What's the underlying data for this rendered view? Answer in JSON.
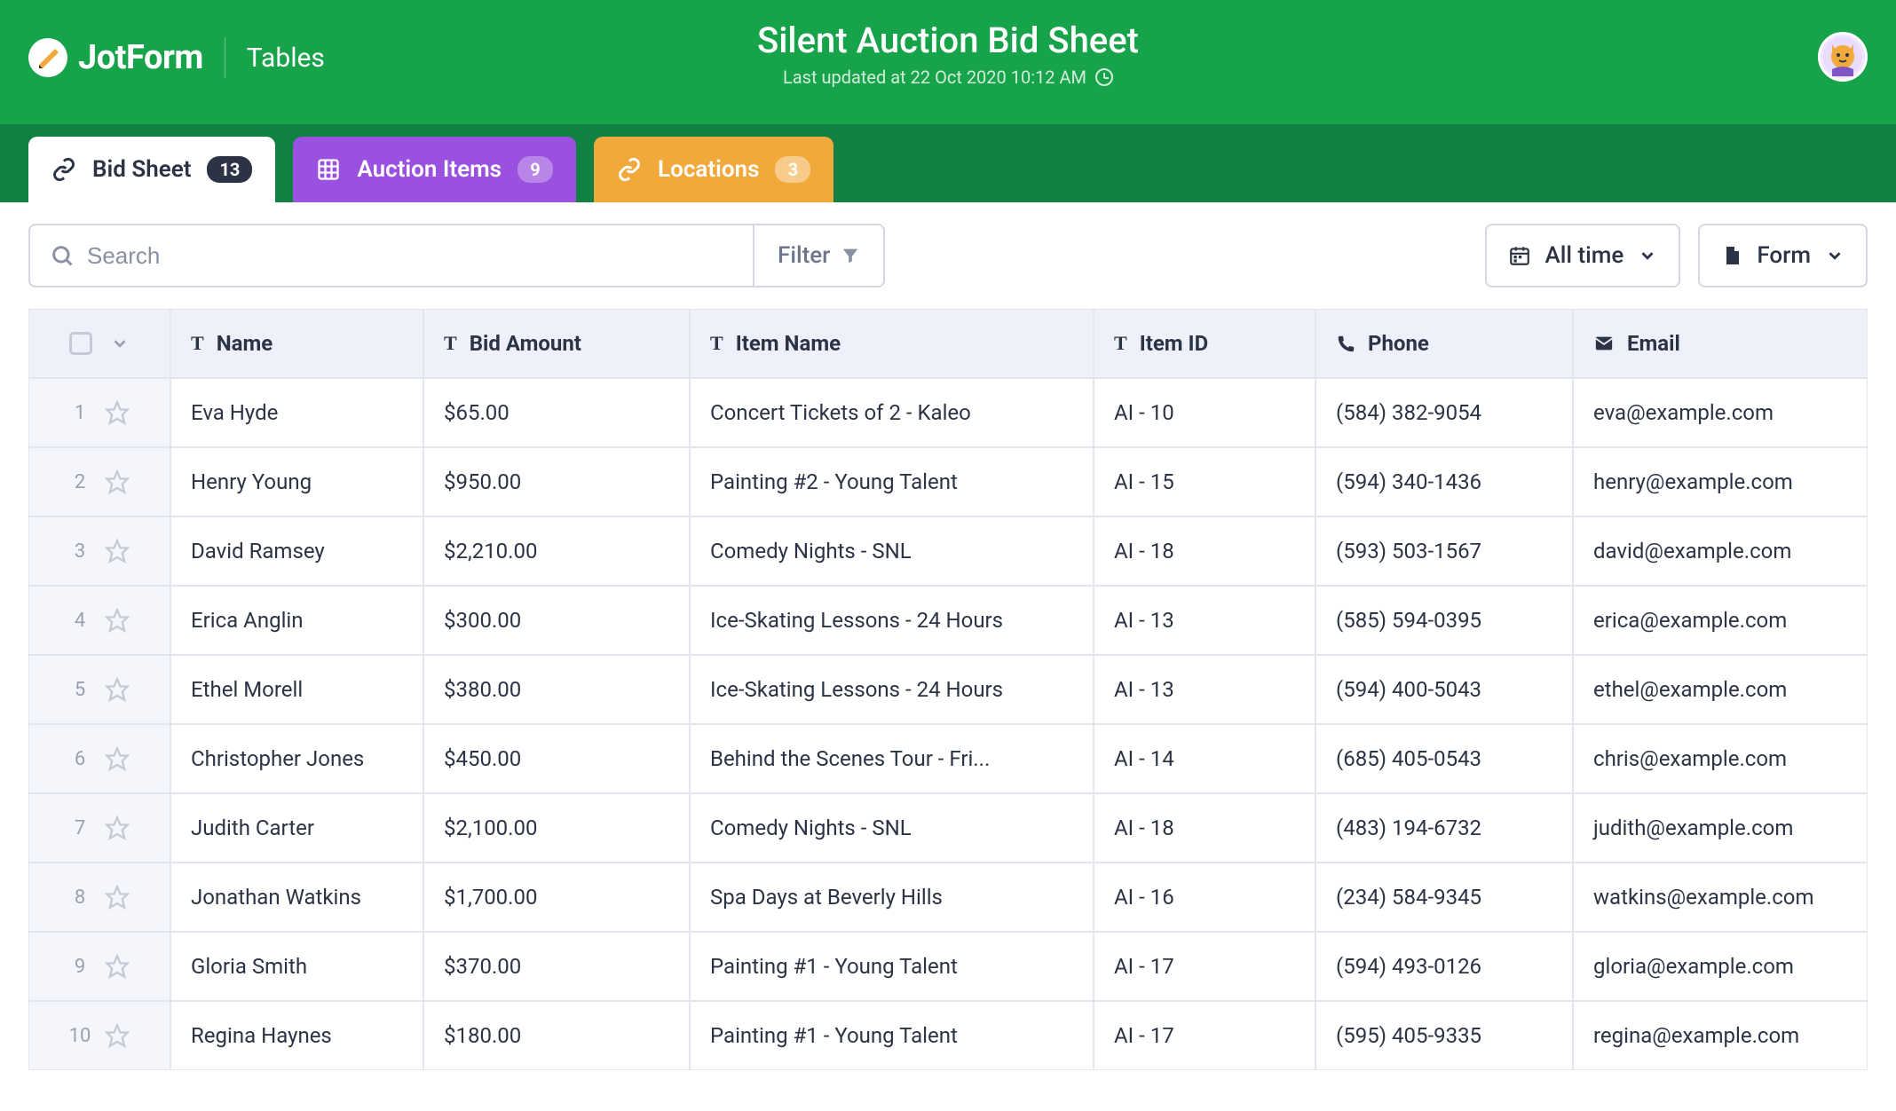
{
  "brand": {
    "name": "JotForm",
    "section": "Tables"
  },
  "document": {
    "title": "Silent Auction Bid Sheet",
    "subtitle": "Last updated at 22 Oct 2020 10:12 AM"
  },
  "tabs": [
    {
      "label": "Bid Sheet",
      "count": "13"
    },
    {
      "label": "Auction Items",
      "count": "9"
    },
    {
      "label": "Locations",
      "count": "3"
    }
  ],
  "toolbar": {
    "search_placeholder": "Search",
    "filter_label": "Filter",
    "time_label": "All time",
    "form_label": "Form"
  },
  "columns": {
    "name": "Name",
    "bid": "Bid Amount",
    "item": "Item Name",
    "itemid": "Item ID",
    "phone": "Phone",
    "email": "Email"
  },
  "rows": [
    {
      "n": "1",
      "name": "Eva Hyde",
      "bid": "$65.00",
      "item": "Concert Tickets of 2 - Kaleo",
      "itemid": "AI - 10",
      "phone": "(584) 382-9054",
      "email": "eva@example.com"
    },
    {
      "n": "2",
      "name": "Henry Young",
      "bid": "$950.00",
      "item": "Painting #2 - Young Talent",
      "itemid": "AI - 15",
      "phone": "(594) 340-1436",
      "email": "henry@example.com"
    },
    {
      "n": "3",
      "name": "David Ramsey",
      "bid": "$2,210.00",
      "item": "Comedy Nights - SNL",
      "itemid": "AI - 18",
      "phone": "(593) 503-1567",
      "email": "david@example.com"
    },
    {
      "n": "4",
      "name": "Erica Anglin",
      "bid": "$300.00",
      "item": "Ice-Skating Lessons - 24 Hours",
      "itemid": "AI - 13",
      "phone": "(585) 594-0395",
      "email": "erica@example.com"
    },
    {
      "n": "5",
      "name": "Ethel Morell",
      "bid": "$380.00",
      "item": "Ice-Skating Lessons - 24 Hours",
      "itemid": "AI - 13",
      "phone": "(594) 400-5043",
      "email": "ethel@example.com"
    },
    {
      "n": "6",
      "name": "Christopher Jones",
      "bid": "$450.00",
      "item": "Behind the Scenes Tour - Fri...",
      "itemid": "AI - 14",
      "phone": "(685) 405-0543",
      "email": "chris@example.com"
    },
    {
      "n": "7",
      "name": "Judith Carter",
      "bid": "$2,100.00",
      "item": "Comedy Nights - SNL",
      "itemid": "AI - 18",
      "phone": "(483) 194-6732",
      "email": "judith@example.com"
    },
    {
      "n": "8",
      "name": "Jonathan Watkins",
      "bid": "$1,700.00",
      "item": "Spa Days at Beverly Hills",
      "itemid": "AI - 16",
      "phone": "(234) 584-9345",
      "email": "watkins@example.com"
    },
    {
      "n": "9",
      "name": "Gloria Smith",
      "bid": "$370.00",
      "item": "Painting #1 - Young Talent",
      "itemid": "AI - 17",
      "phone": "(594) 493-0126",
      "email": "gloria@example.com"
    },
    {
      "n": "10",
      "name": "Regina Haynes",
      "bid": "$180.00",
      "item": "Painting #1 - Young Talent",
      "itemid": "AI - 17",
      "phone": "(595) 405-9335",
      "email": "regina@example.com"
    }
  ]
}
